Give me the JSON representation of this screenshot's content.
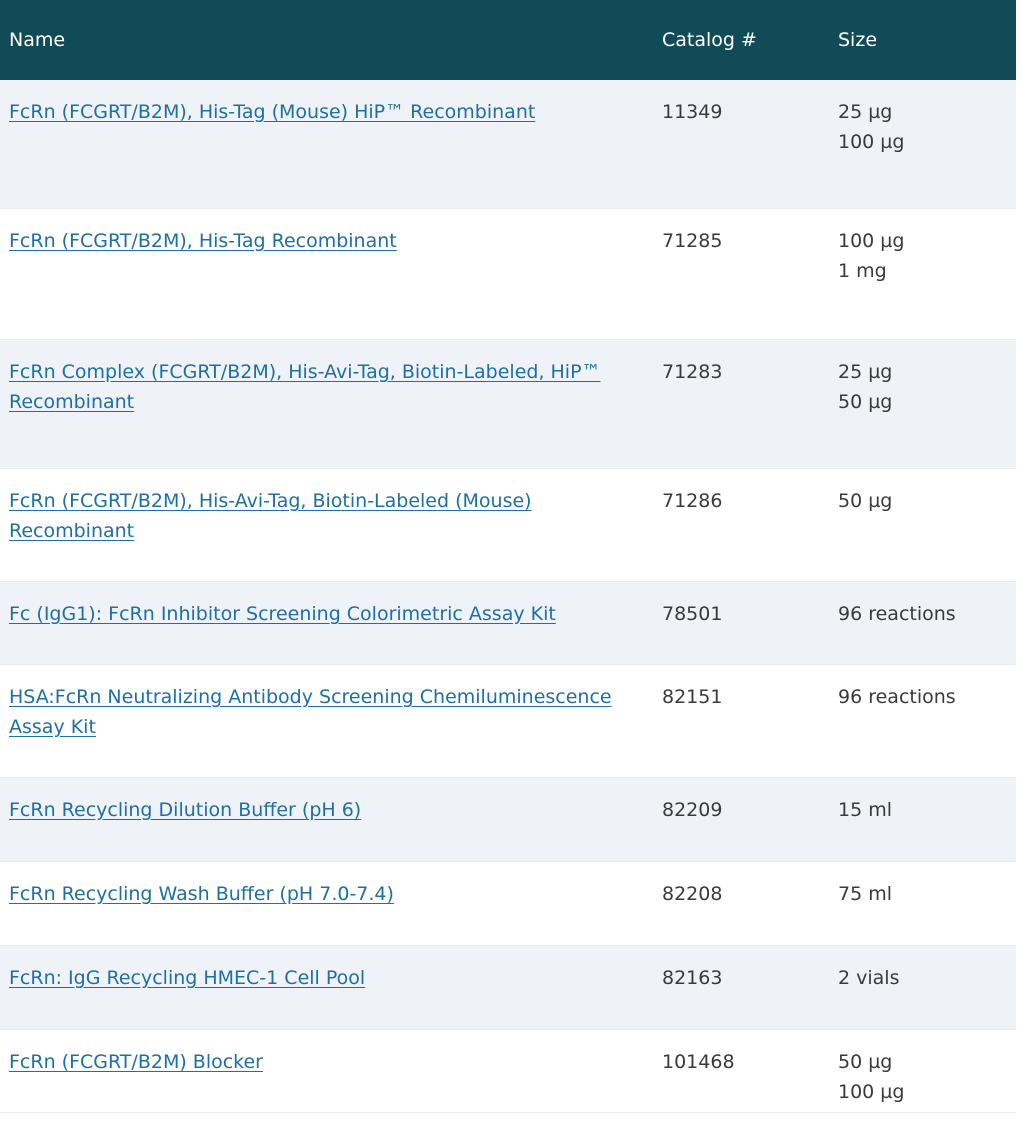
{
  "headers": {
    "name": "Name",
    "catalog": "Catalog #",
    "size": "Size"
  },
  "rows": [
    {
      "name": "FcRn (FCGRT/B2M), His-Tag (Mouse) HiP™ Recombinant",
      "catalog": "11349",
      "sizes": [
        "25 µg",
        "100 µg"
      ]
    },
    {
      "name": "FcRn (FCGRT/B2M), His-Tag Recombinant",
      "catalog": "71285",
      "sizes": [
        "100 µg",
        "1 mg"
      ]
    },
    {
      "name": "FcRn Complex (FCGRT/B2M), His-Avi-Tag, Biotin-Labeled, HiP™ Recombinant",
      "catalog": "71283",
      "sizes": [
        "25 µg",
        "50 µg"
      ]
    },
    {
      "name": "FcRn (FCGRT/B2M), His-Avi-Tag, Biotin-Labeled (Mouse) Recombinant",
      "catalog": "71286",
      "sizes": [
        "50 µg"
      ]
    },
    {
      "name": "Fc (IgG1): FcRn Inhibitor Screening Colorimetric Assay Kit",
      "catalog": "78501",
      "sizes": [
        "96 reactions"
      ]
    },
    {
      "name": "HSA:FcRn Neutralizing Antibody Screening Chemiluminescence Assay Kit",
      "catalog": "82151",
      "sizes": [
        "96 reactions"
      ]
    },
    {
      "name": "FcRn Recycling Dilution Buffer (pH 6)",
      "catalog": "82209",
      "sizes": [
        "15 ml"
      ]
    },
    {
      "name": "FcRn Recycling Wash Buffer (pH 7.0-7.4)",
      "catalog": "82208",
      "sizes": [
        "75 ml"
      ]
    },
    {
      "name": "FcRn: IgG Recycling HMEC-1 Cell Pool",
      "catalog": "82163",
      "sizes": [
        "2 vials"
      ]
    },
    {
      "name": "FcRn (FCGRT/B2M) Blocker",
      "catalog": "101468",
      "sizes": [
        "50 µg",
        "100 µg"
      ]
    }
  ],
  "colors": {
    "header_bg": "#124b58",
    "link": "#1d6fa5",
    "alt_row_bg": "#eff3f7"
  }
}
